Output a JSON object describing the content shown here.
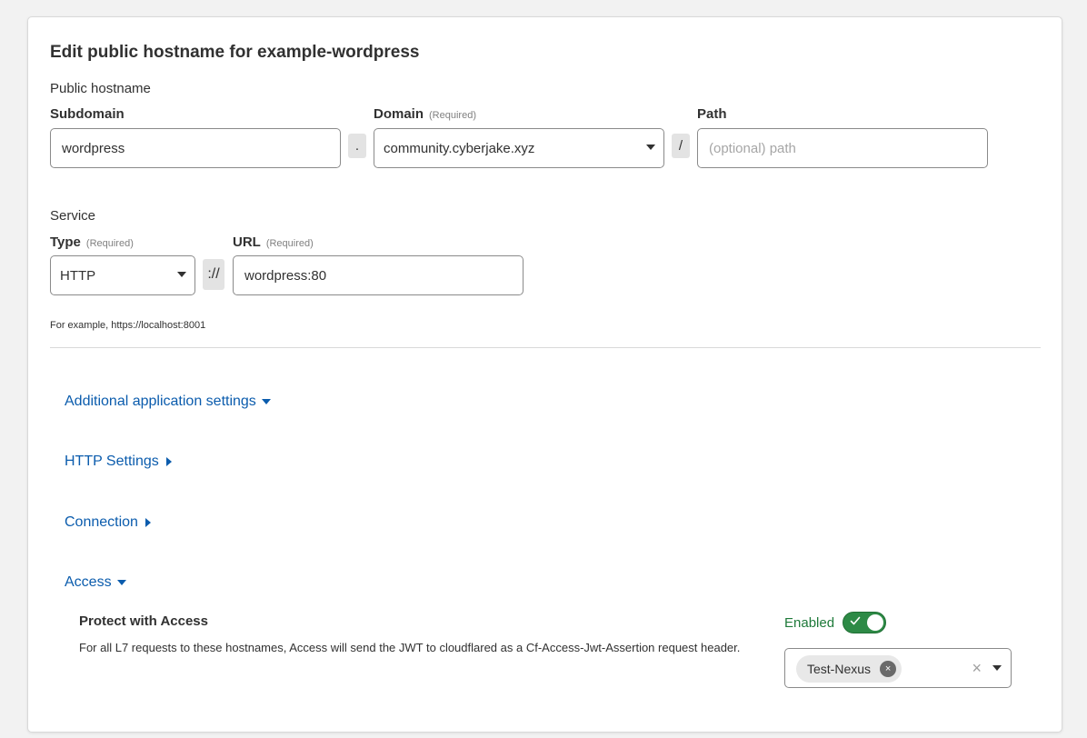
{
  "form": {
    "title": "Edit public hostname for example-wordpress",
    "public_hostname": {
      "label": "Public hostname",
      "subdomain": {
        "label": "Subdomain",
        "value": "wordpress"
      },
      "dot_separator": ".",
      "domain": {
        "label": "Domain",
        "required": "(Required)",
        "value": "community.cyberjake.xyz"
      },
      "slash_separator": "/",
      "path": {
        "label": "Path",
        "placeholder": "(optional) path"
      }
    },
    "service": {
      "label": "Service",
      "type": {
        "label": "Type",
        "required": "(Required)",
        "value": "HTTP"
      },
      "scheme_separator": "://",
      "url": {
        "label": "URL",
        "required": "(Required)",
        "value": "wordpress:80"
      },
      "help": "For example, https://localhost:8001"
    }
  },
  "sections": {
    "additional": "Additional application settings",
    "http": "HTTP Settings",
    "connection": "Connection",
    "access": "Access"
  },
  "access": {
    "protect_title": "Protect with Access",
    "protect_desc": "For all L7 requests to these hostnames, Access will send the JWT to cloudflared as a Cf-Access-Jwt-Assertion request header.",
    "enabled_label": "Enabled",
    "toggle_on": true,
    "applications": [
      "Test-Nexus"
    ],
    "chip_remove": "×",
    "clear_all": "×"
  },
  "colors": {
    "link": "#0b5cad",
    "toggle": "#2d8a46",
    "enabled_text": "#1e7a3a"
  }
}
